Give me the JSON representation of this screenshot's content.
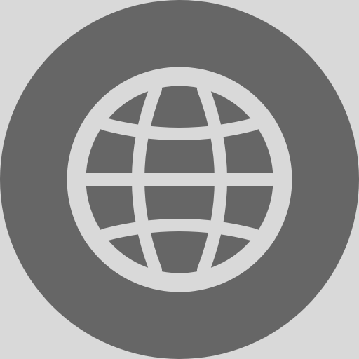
{
  "icon": {
    "name": "globe-icon",
    "background_color": "#d9d9d9",
    "circle_color": "#666666",
    "glyph_color": "#d9d9d9"
  }
}
